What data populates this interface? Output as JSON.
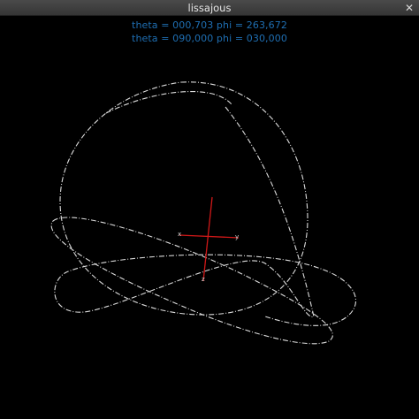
{
  "window": {
    "title": "lissajous",
    "close_icon": "close-icon"
  },
  "info": {
    "line1": "theta = 000,703 phi = 263,672",
    "line2": "theta = 090,000 phi = 030,000"
  },
  "colors": {
    "background": "#000000",
    "curve": "#dcdcdc",
    "axes": "#d01818",
    "info_text": "#1f6fb3"
  }
}
